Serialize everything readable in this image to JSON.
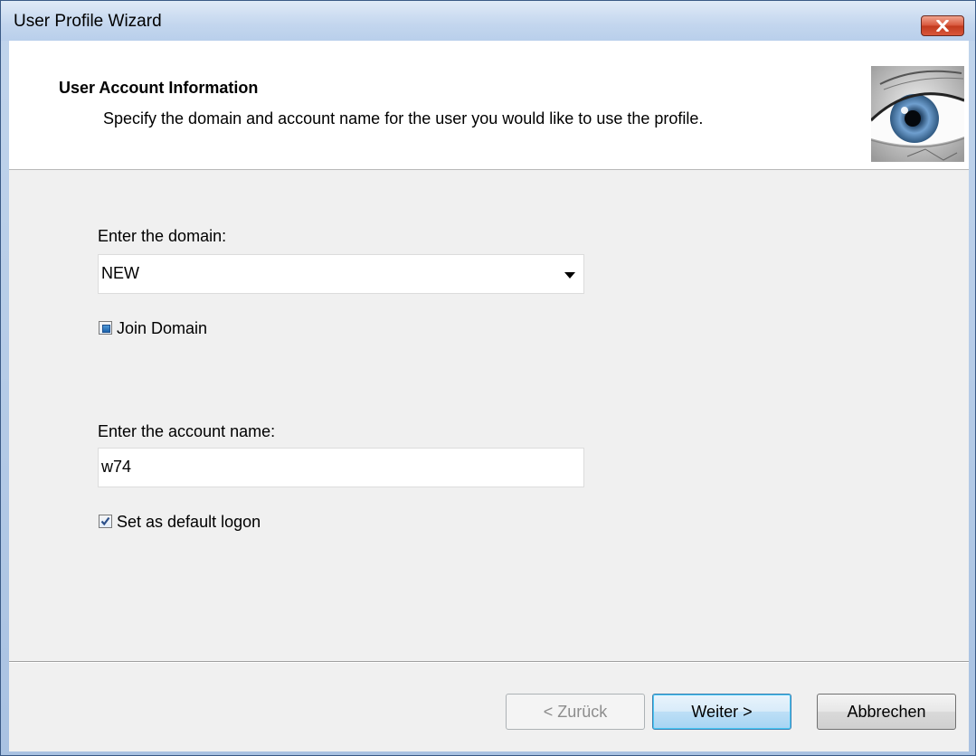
{
  "window": {
    "title": "User Profile Wizard"
  },
  "header": {
    "title": "User Account Information",
    "subtitle": "Specify the domain and account name for the user you would like to use the profile."
  },
  "domain": {
    "label": "Enter the domain:",
    "selected": "NEW",
    "join_label": "Join Domain",
    "join_state": "indeterminate"
  },
  "account": {
    "label": "Enter the account name:",
    "value": "w74",
    "default_logon_label": "Set as default logon",
    "default_logon_checked": true
  },
  "buttons": {
    "back": "< Zurück",
    "next": "Weiter >",
    "cancel": "Abbrechen"
  },
  "colors": {
    "close_button": "#d8553a",
    "primary_button_border": "#3c7fb1",
    "checkbox_fill": "#1b62ac"
  },
  "icons": {
    "close": "close-icon",
    "header_image": "eye-image"
  }
}
